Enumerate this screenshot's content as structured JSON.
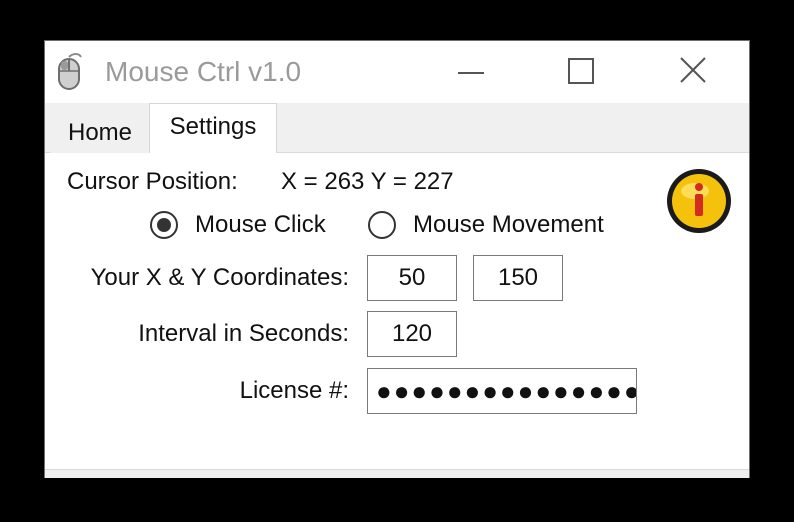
{
  "window": {
    "title": "Mouse Ctrl v1.0",
    "app_icon": "mouse-icon",
    "controls": {
      "minimize_icon": "minimize-icon",
      "maximize_icon": "maximize-icon",
      "close_icon": "close-icon"
    }
  },
  "tabs": [
    {
      "label": "Home",
      "selected": false
    },
    {
      "label": "Settings",
      "selected": true
    }
  ],
  "settings": {
    "cursor_position_label": "Cursor Position:",
    "cursor_position_value": "X = 263 Y = 227",
    "info_icon": "info-icon",
    "mode_options": [
      {
        "label": "Mouse Click",
        "selected": true
      },
      {
        "label": "Mouse Movement",
        "selected": false
      }
    ],
    "coordinates_label": "Your X & Y Coordinates:",
    "x_value": "50",
    "y_value": "150",
    "interval_label": "Interval in Seconds:",
    "interval_value": "120",
    "license_label": "License #:",
    "license_value": "●●●●●●●●●●●●●●●"
  },
  "colors": {
    "background": "#000000",
    "window": "#ffffff",
    "title_text": "#9a9a9a",
    "tab_strip": "#f0f0f0",
    "info_badge": "#f4c20d",
    "info_letter": "#d62a1e"
  }
}
